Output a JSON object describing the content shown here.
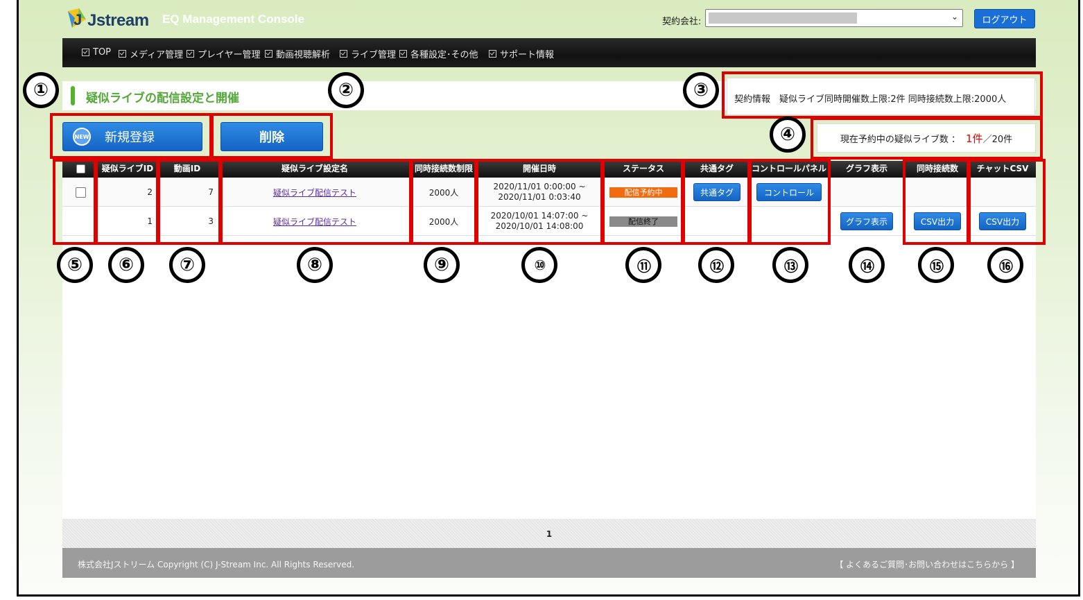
{
  "header": {
    "logo_text": "Jstream",
    "console_title": "EQ Management Console",
    "contract_label": "契約会社:",
    "logout": "ログアウト"
  },
  "nav": [
    "TOP",
    "メディア管理",
    "プレイヤー管理",
    "動画視聴解析",
    "ライブ管理",
    "各種設定･その他",
    "サポート情報"
  ],
  "page_title": "疑似ライブの配信設定と開催",
  "contract_info": "契約情報　疑似ライブ同時開催数上限:2件  同時接続数上限:2000人",
  "reserved": {
    "label": "現在予約中の疑似ライブ数 ：",
    "count": "1件",
    "total": "／20件"
  },
  "buttons": {
    "new_badge": "NEW",
    "new": "新規登録",
    "delete": "削除"
  },
  "columns": [
    "疑似ライブID",
    "動画ID",
    "疑似ライブ設定名",
    "同時接続数制限",
    "開催日時",
    "ステータス",
    "共通タグ",
    "コントロールパネル",
    "グラフ表示",
    "同時接続数",
    "チャットCSV"
  ],
  "rows": [
    {
      "id": "2",
      "video_id": "7",
      "name": "疑似ライブ配信テスト",
      "limit": "2000人",
      "start": "2020/11/01 0:00:00 ~",
      "end": "2020/11/01 0:03:40",
      "status": "配信予約中",
      "status_color": "#f26b0f",
      "tag_btn": "共通タグ",
      "control_btn": "コントロール"
    },
    {
      "id": "1",
      "video_id": "3",
      "name": "疑似ライブ配信テスト",
      "limit": "2000人",
      "start": "2020/10/01 14:07:00 ~",
      "end": "2020/10/01 14:08:00",
      "status": "配信終了",
      "status_color": "#8a8a8a",
      "graph_btn": "グラフ表示",
      "csv_btn": "CSV出力",
      "chat_btn": "CSV出力"
    }
  ],
  "pager": "1",
  "footer": {
    "copyright": "株式会社Jストリーム  Copyright (C) J-Stream Inc. All Rights Reserved.",
    "faq": "【 よくあるご質問･お問い合わせはこちらから 】"
  },
  "annotations": [
    "①",
    "②",
    "③",
    "④",
    "⑤",
    "⑥",
    "⑦",
    "⑧",
    "⑨",
    "⑩",
    "⑪",
    "⑫",
    "⑬",
    "⑭",
    "⑮",
    "⑯"
  ]
}
